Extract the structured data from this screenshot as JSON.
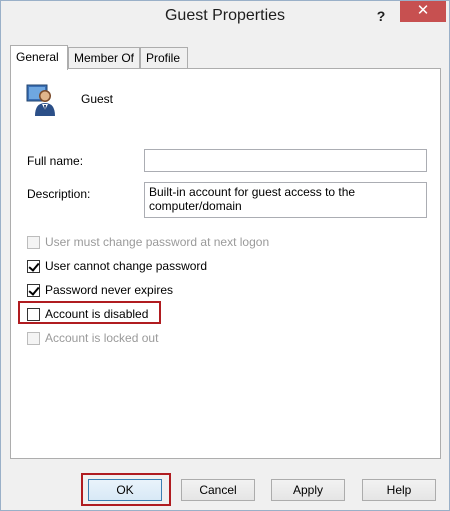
{
  "window": {
    "title": "Guest Properties",
    "help_label": "?",
    "close_label": "✕"
  },
  "tabs": [
    {
      "label": "General",
      "active": true
    },
    {
      "label": "Member Of",
      "active": false
    },
    {
      "label": "Profile",
      "active": false
    }
  ],
  "user": {
    "icon": "user-account-icon",
    "name": "Guest"
  },
  "fields": {
    "full_name_label": "Full name:",
    "full_name_value": "",
    "description_label": "Description:",
    "description_value": "Built-in account for guest access to the computer/domain"
  },
  "options": [
    {
      "label": "User must change password at next logon",
      "checked": false,
      "enabled": false
    },
    {
      "label": "User cannot change password",
      "checked": true,
      "enabled": true
    },
    {
      "label": "Password never expires",
      "checked": true,
      "enabled": true
    },
    {
      "label": "Account is disabled",
      "checked": false,
      "enabled": true,
      "highlighted": true
    },
    {
      "label": "Account is locked out",
      "checked": false,
      "enabled": false
    }
  ],
  "buttons": {
    "ok": "OK",
    "cancel": "Cancel",
    "apply": "Apply",
    "help": "Help"
  },
  "colors": {
    "highlight": "#b01c20",
    "close_button": "#c75050"
  }
}
